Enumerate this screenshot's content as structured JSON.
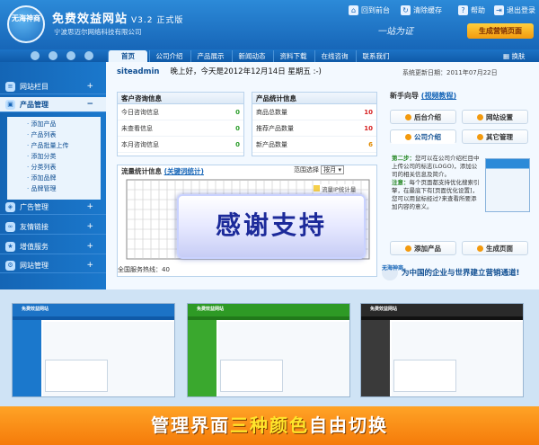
{
  "header": {
    "logo_text": "无海神商",
    "brand": "免费效益网站",
    "version": "V3.2 正式版",
    "company": "宁波思迈尔网络科技有限公司",
    "links": [
      "回到前台",
      "清除缓存",
      "帮助",
      "退出登录"
    ],
    "signature": "一站为证",
    "pro_button": "生成营销页面"
  },
  "nav": {
    "tabs": [
      "首页",
      "公司介绍",
      "产品展示",
      "新闻动态",
      "资料下载",
      "在线咨询",
      "联系我们"
    ],
    "switch_label": "换肤"
  },
  "sidebar": {
    "sections": [
      {
        "label": "网站栏目",
        "toggle": "+"
      },
      {
        "label": "产品管理",
        "toggle": "−"
      },
      {
        "label": "广告管理",
        "toggle": "+"
      },
      {
        "label": "友情链接",
        "toggle": "+"
      },
      {
        "label": "增值服务",
        "toggle": "+"
      },
      {
        "label": "网站管理",
        "toggle": "+"
      }
    ],
    "sub_items": [
      "添加产品",
      "产品列表",
      "产品批量上传",
      "添加分类",
      "分类列表",
      "添加品牌",
      "品牌管理"
    ]
  },
  "welcome": {
    "user": "siteadmin",
    "greeting": "晚上好，今天是2012年12月14日 星期五 :-)",
    "updated": "系统更新日期：2011年07月22日"
  },
  "customer_stats": {
    "title": "客户咨询信息",
    "rows": [
      {
        "label": "今日咨询信息",
        "value": "0"
      },
      {
        "label": "未查看信息",
        "value": "0"
      },
      {
        "label": "本月咨询信息",
        "value": "0"
      }
    ]
  },
  "product_stats": {
    "title": "产品统计信息",
    "rows": [
      {
        "label": "商品总数量",
        "value": "10"
      },
      {
        "label": "推荐产品数量",
        "value": "10"
      },
      {
        "label": "新产品数量",
        "value": "6"
      }
    ]
  },
  "traffic": {
    "title": "流量统计信息",
    "link": "(关键词统计)",
    "range_label": "范围选择",
    "range_value": "按月",
    "legend": "流量IP统计量",
    "total_label": "全国服务热线：40"
  },
  "guide": {
    "title": "新手向导",
    "link": "(视频教程)",
    "tabs": [
      "后台介绍",
      "网站设置",
      "公司介绍",
      "其它管理"
    ],
    "step_label": "第二步：",
    "step_text": "您可以在公司介绍栏目中上传公司的标志(LOGO)，添加公司的相关信息及简介。",
    "note_label": "注意：",
    "note_text": "每个页面都支持优化搜索引擎，在最底下有[页面优化设置]，您可以用鼠标经过?来查看所要添加内容的意义。",
    "buttons": [
      "添加产品",
      "生成页面"
    ]
  },
  "overlay_text": "感谢支持",
  "slogan": "为中国的企业与世界建立营销通道!",
  "thumbnails": [
    {
      "theme": "blue",
      "title": "免费效益网站"
    },
    {
      "theme": "green",
      "title": "免费效益网站"
    },
    {
      "theme": "black",
      "title": "免费效益网站"
    }
  ],
  "footer": {
    "part1": "管理界面",
    "highlight": "三种颜色",
    "part2": "自由切换"
  },
  "chart_data": {
    "type": "line",
    "series": [
      {
        "name": "流量IP统计量",
        "values": []
      }
    ],
    "grid": true
  },
  "colors": {
    "primary": "#1766b8",
    "accent": "#f39a0e",
    "footer": "#f57b0a"
  }
}
